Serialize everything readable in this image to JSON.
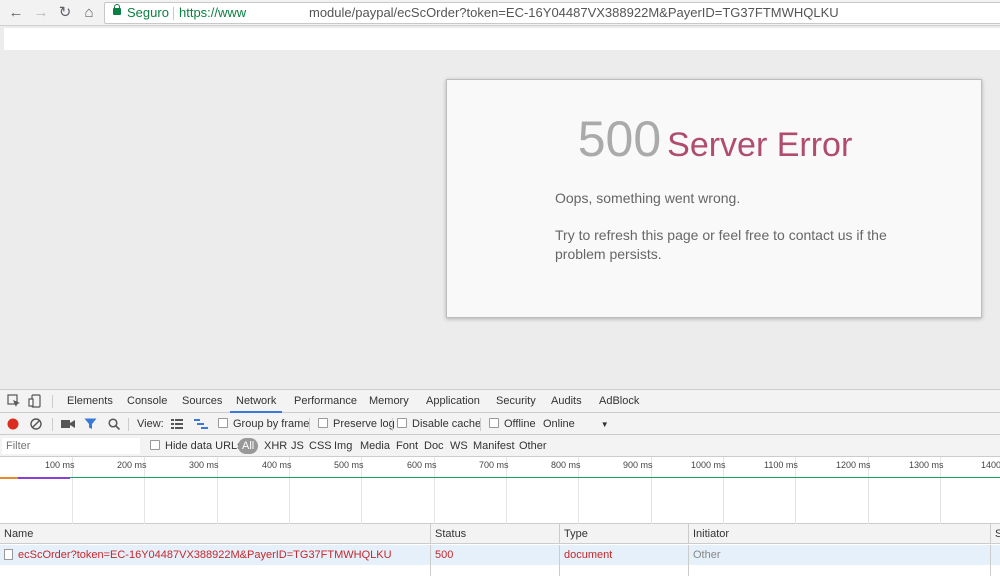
{
  "browser": {
    "nav": {
      "back_icon": "←",
      "forward_icon": "→",
      "reload_icon": "↻",
      "home_icon": "⌂"
    },
    "secure_label": "Seguro",
    "url_start": "https://www",
    "url_end": "module/paypal/ecScOrder?token=EC-16Y04487VX388922M&PayerID=TG37FTMWHQLKU"
  },
  "error_page": {
    "code": "500",
    "title": "Server Error",
    "message": "Oops, something went wrong.",
    "hint": "Try to refresh this page or feel free to contact us if the problem persists.",
    "colors": {
      "code": "#aaaaaa",
      "title": "#b04c70"
    }
  },
  "devtools": {
    "tabs": [
      "Elements",
      "Console",
      "Sources",
      "Network",
      "Performance",
      "Memory",
      "Application",
      "Security",
      "Audits",
      "AdBlock"
    ],
    "active_tab": "Network",
    "toolbar": {
      "view_label": "View:",
      "group_by_frame": "Group by frame",
      "preserve_log": "Preserve log",
      "disable_cache": "Disable cache",
      "offline": "Offline",
      "throttling": "Online"
    },
    "filter": {
      "placeholder": "Filter",
      "hide_data_urls": "Hide data URLs",
      "types": [
        "All",
        "XHR",
        "JS",
        "CSS",
        "Img",
        "Media",
        "Font",
        "Doc",
        "WS",
        "Manifest",
        "Other"
      ],
      "active_type": "All"
    },
    "timeline_ticks": [
      "100 ms",
      "200 ms",
      "300 ms",
      "400 ms",
      "500 ms",
      "600 ms",
      "700 ms",
      "800 ms",
      "900 ms",
      "1000 ms",
      "1100 ms",
      "1200 ms",
      "1300 ms",
      "1400"
    ],
    "table": {
      "columns": [
        "Name",
        "Status",
        "Type",
        "Initiator",
        "S"
      ],
      "rows": [
        {
          "name": "ecScOrder?token=EC-16Y04487VX388922M&PayerID=TG37FTMWHQLKU",
          "status": "500",
          "type": "document",
          "initiator": "Other"
        }
      ],
      "error_color": "#c62828"
    }
  }
}
